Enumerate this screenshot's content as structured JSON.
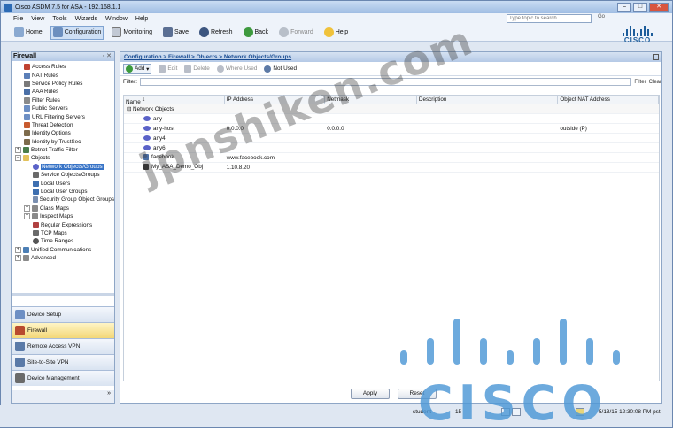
{
  "window": {
    "title": "Cisco ASDM 7.5 for ASA - 192.168.1.1"
  },
  "menu": [
    "File",
    "View",
    "Tools",
    "Wizards",
    "Window",
    "Help"
  ],
  "help_search": {
    "placeholder": "Type topic to search",
    "go": "Go"
  },
  "toolbar": {
    "home": "Home",
    "configuration": "Configuration",
    "monitoring": "Monitoring",
    "save": "Save",
    "refresh": "Refresh",
    "back": "Back",
    "forward": "Forward",
    "help": "Help"
  },
  "brand": {
    "logo_word": "CISCO"
  },
  "left_panel": {
    "title": "Firewall",
    "tree": [
      "Access Rules",
      "NAT Rules",
      "Service Policy Rules",
      "AAA Rules",
      "Filter Rules",
      "Public Servers",
      "URL Filtering Servers",
      "Threat Detection",
      "Identity Options",
      "Identity by TrustSec",
      "Botnet Traffic Filter",
      "Objects",
      "Network Objects/Groups",
      "Service Objects/Groups",
      "Local Users",
      "Local User Groups",
      "Security Group Object Groups",
      "Class Maps",
      "Inspect Maps",
      "Regular Expressions",
      "TCP Maps",
      "Time Ranges",
      "Unified Communications",
      "Advanced"
    ],
    "nav": [
      "Device Setup",
      "Firewall",
      "Remote Access VPN",
      "Site-to-Site VPN",
      "Device Management"
    ]
  },
  "breadcrumb": "Configuration > Firewall > Objects > Network Objects/Groups",
  "main_toolbar": {
    "add": "Add",
    "edit": "Edit",
    "delete": "Delete",
    "where_used": "Where Used",
    "not_used": "Not Used"
  },
  "filter": {
    "label": "Filter:",
    "filter_btn": "Filter",
    "clear_btn": "Clear"
  },
  "table": {
    "columns": [
      "Name",
      "IP Address",
      "Netmask",
      "Description",
      "Object NAT Address"
    ],
    "sort_marker": "1",
    "group": "Network Objects",
    "rows": [
      {
        "name": "any",
        "ip": "",
        "mask": "",
        "desc": "",
        "nat": "",
        "icon": "network-object-icon"
      },
      {
        "name": "any-host",
        "ip": "0.0.0.0",
        "mask": "0.0.0.0",
        "desc": "",
        "nat": "outside (P)",
        "icon": "network-object-icon"
      },
      {
        "name": "any4",
        "ip": "",
        "mask": "",
        "desc": "",
        "nat": "",
        "icon": "network-object-icon"
      },
      {
        "name": "any6",
        "ip": "",
        "mask": "",
        "desc": "",
        "nat": "",
        "icon": "network-object-icon"
      },
      {
        "name": "facebook",
        "ip": "www.facebook.com",
        "mask": "",
        "desc": "",
        "nat": "",
        "icon": "fqdn-object-icon"
      },
      {
        "name": "My_ASA_Demo_Obj",
        "ip": "1.10.8.20",
        "mask": "",
        "desc": "",
        "nat": "",
        "icon": "host-object-icon"
      }
    ]
  },
  "buttons": {
    "apply": "Apply",
    "reset": "Reset"
  },
  "status": {
    "user": "student",
    "count": "15",
    "datetime": "5/13/15 12:30:08 PM pst"
  },
  "watermark": {
    "text": "jpnshiken.com",
    "logo_word": "CISCO"
  },
  "colors": {
    "accent": "#3874c7",
    "cisco_blue": "#4d97d6",
    "nav_active": "#f3d778"
  }
}
